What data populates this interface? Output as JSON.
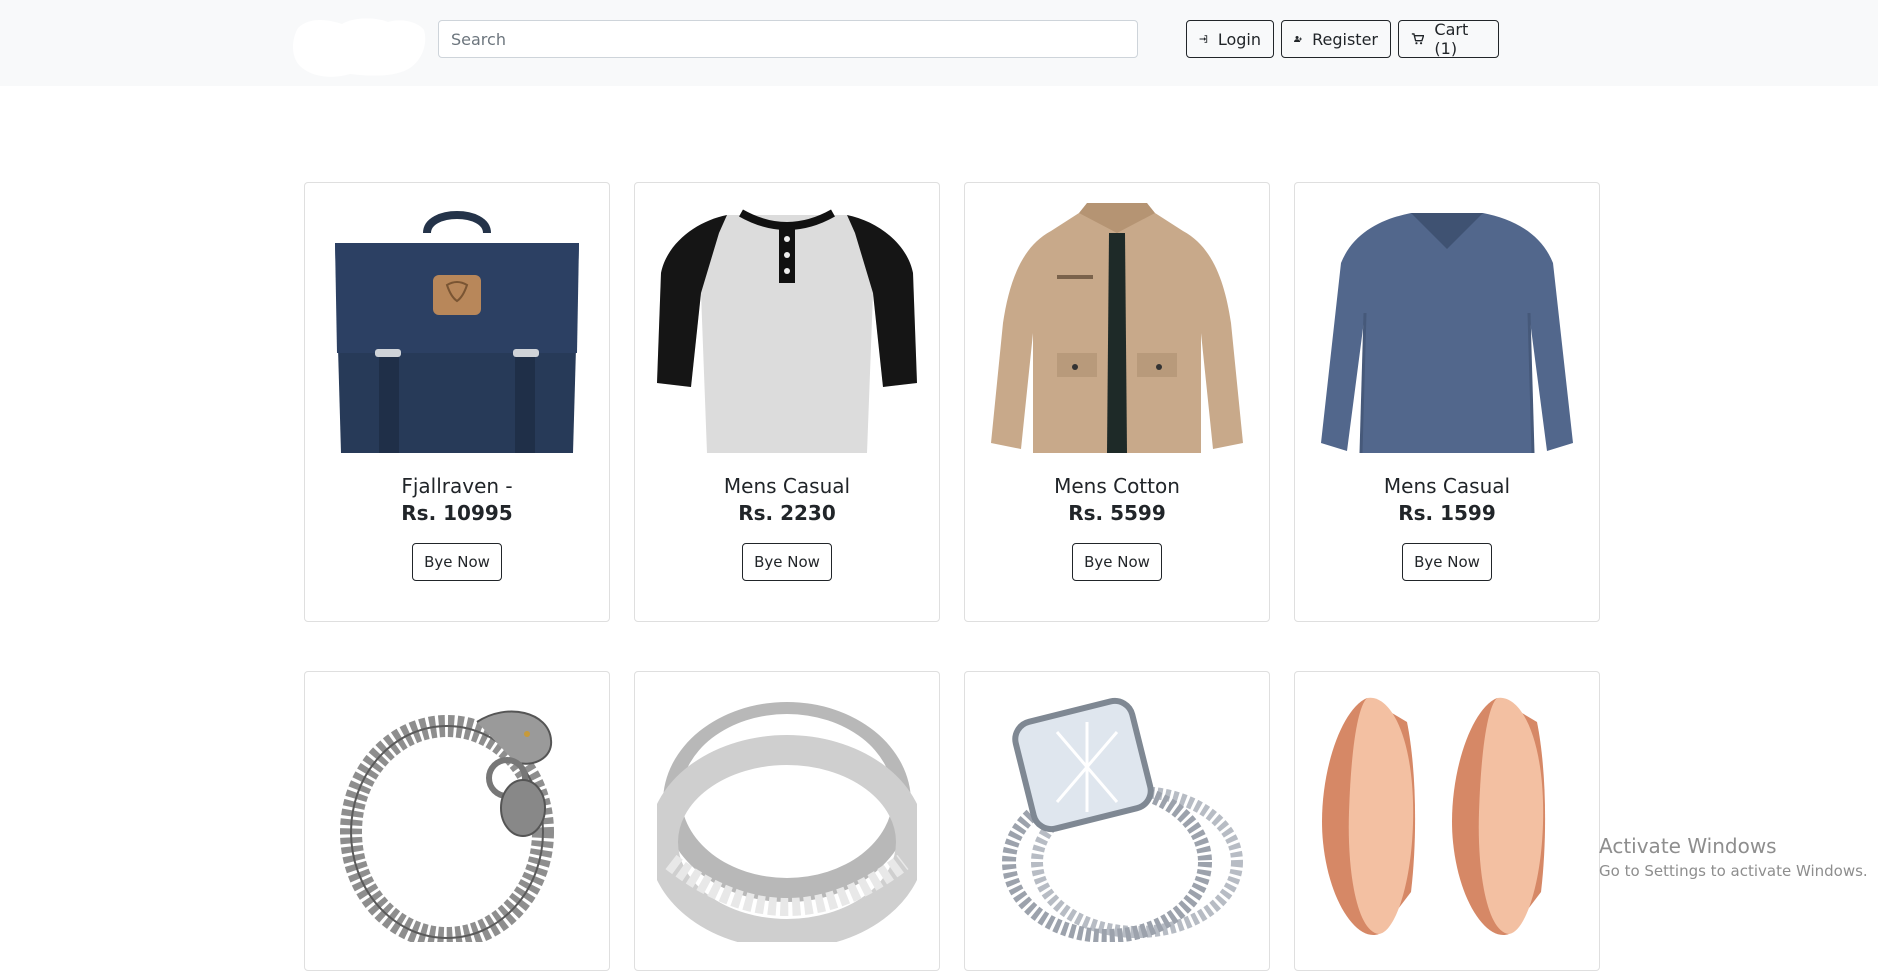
{
  "header": {
    "search_placeholder": "Search",
    "login_label": "Login",
    "register_label": "Register",
    "cart_label": "Cart (1)"
  },
  "products": [
    {
      "title": "Fjallraven -",
      "price": "Rs. 10995",
      "button": "Bye Now"
    },
    {
      "title": "Mens Casual",
      "price": "Rs. 2230",
      "button": "Bye Now"
    },
    {
      "title": "Mens Cotton",
      "price": "Rs. 5599",
      "button": "Bye Now"
    },
    {
      "title": "Mens Casual",
      "price": "Rs. 1599",
      "button": "Bye Now"
    }
  ],
  "watermark": {
    "line1": "Activate Windows",
    "line2": "Go to Settings to activate Windows."
  },
  "colors": {
    "navbar_bg": "#f8f9fa",
    "text": "#212529",
    "border": "#dee2e6"
  }
}
